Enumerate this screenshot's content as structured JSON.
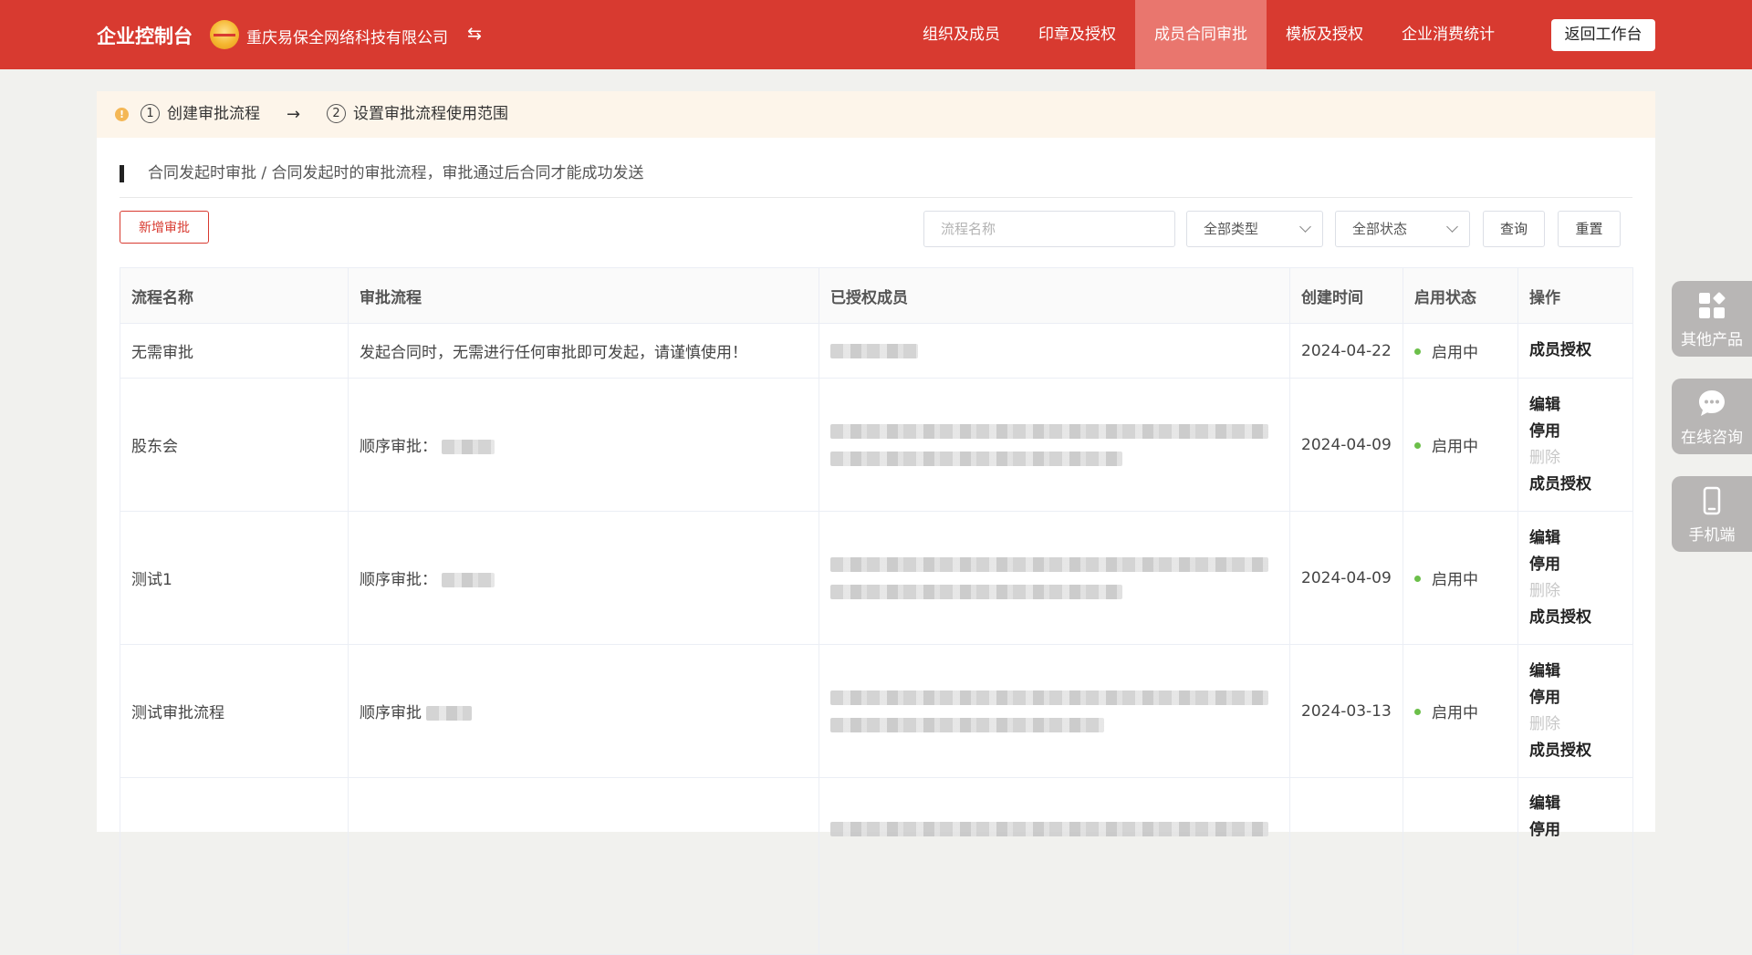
{
  "header": {
    "brand": "企业控制台",
    "company_name": "重庆易保全网络科技有限公司",
    "switch_icon": "⇆",
    "nav": [
      {
        "label": "组织及成员",
        "active": false
      },
      {
        "label": "印章及授权",
        "active": false
      },
      {
        "label": "成员合同审批",
        "active": true
      },
      {
        "label": "模板及授权",
        "active": false
      },
      {
        "label": "企业消费统计",
        "active": false
      }
    ],
    "back_label": "返回工作台",
    "colors": {
      "primary": "#d83a30",
      "active_tab": "#e9766e"
    }
  },
  "steps": {
    "warn_icon": "!",
    "step1": {
      "num": "1",
      "label": "创建审批流程"
    },
    "arrow": "→",
    "step2": {
      "num": "2",
      "label": "设置审批流程使用范围"
    }
  },
  "section": {
    "title": "合同发起时审批 / 合同发起时的审批流程，审批通过后合同才能成功发送"
  },
  "toolbar": {
    "add_label": "新增审批",
    "search_placeholder": "流程名称",
    "type_select": "全部类型",
    "status_select": "全部状态",
    "query_label": "查询",
    "reset_label": "重置"
  },
  "table": {
    "headers": [
      "流程名称",
      "审批流程",
      "已授权成员",
      "创建时间",
      "启用状态",
      "操作"
    ],
    "rows": [
      {
        "name": "无需审批",
        "flow": "发起合同时，无需进行任何审批即可发起，请谨慎使用！",
        "date": "2024-04-22",
        "status": "启用中",
        "ops": [
          "成员授权"
        ]
      },
      {
        "name": "股东会",
        "flow": "顺序审批：",
        "date": "2024-04-09",
        "status": "启用中",
        "ops": [
          "编辑",
          "停用",
          "删除",
          "成员授权"
        ]
      },
      {
        "name": "测试1",
        "flow": "顺序审批：",
        "date": "2024-04-09",
        "status": "启用中",
        "ops": [
          "编辑",
          "停用",
          "删除",
          "成员授权"
        ]
      },
      {
        "name": "测试审批流程",
        "flow": "顺序审批",
        "date": "2024-03-13",
        "status": "启用中",
        "ops": [
          "编辑",
          "停用",
          "删除",
          "成员授权"
        ]
      },
      {
        "name": "",
        "flow": "",
        "date": "",
        "status": "",
        "ops": [
          "编辑",
          "停用"
        ]
      }
    ],
    "status_color": "#6cbf4a"
  },
  "side": {
    "other": {
      "label": "其他产品",
      "icon": "apps-icon"
    },
    "consult": {
      "label": "在线咨询",
      "icon": "chat-bubble-icon"
    },
    "mobile": {
      "label": "手机端",
      "icon": "phone-icon"
    }
  }
}
